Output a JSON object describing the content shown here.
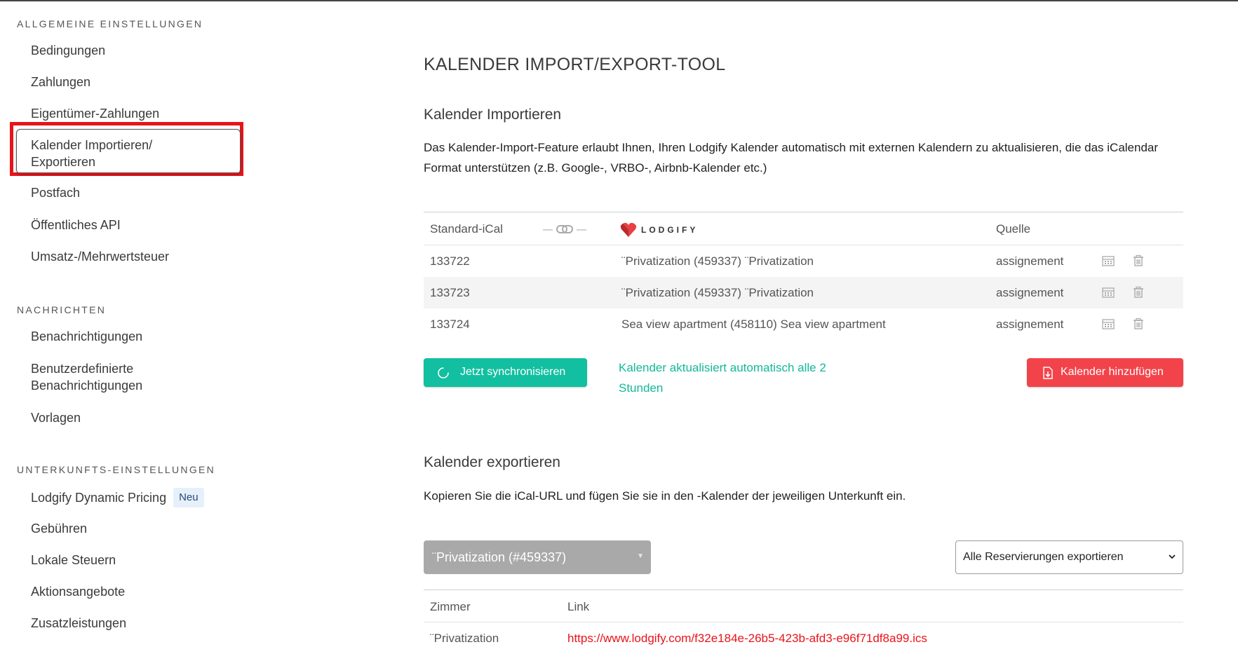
{
  "sidebar": {
    "sections": [
      {
        "heading": "ALLGEMEINE EINSTELLUNGEN",
        "items": [
          "Bedingungen",
          "Zahlungen",
          "Eigentümer-Zahlungen",
          "Kalender Importieren/ Exportieren",
          "Postfach",
          "Öffentliches API",
          "Umsatz-/Mehrwertsteuer"
        ]
      },
      {
        "heading": "NACHRICHTEN",
        "items": [
          "Benachrichtigungen",
          "Benutzerdefinierte Benachrichtigungen",
          "Vorlagen"
        ]
      },
      {
        "heading": "UNTERKUNFTS-EINSTELLUNGEN",
        "items": [
          "Lodgify Dynamic Pricing",
          "Gebühren",
          "Lokale Steuern",
          "Aktionsangebote",
          "Zusatzleistungen"
        ]
      }
    ],
    "new_badge": "Neu",
    "active_item": "Kalender Importieren/ Exportieren"
  },
  "main": {
    "title": "KALENDER IMPORT/EXPORT-TOOL",
    "import": {
      "heading": "Kalender Importieren",
      "description": "Das Kalender-Import-Feature erlaubt Ihnen, Ihren Lodgify Kalender automatisch mit externen Kalendern zu aktualisieren, die das iCalendar Format unterstützen (z.B. Google-, VRBO-, Airbnb-Kalender etc.)",
      "columns": {
        "ical": "Standard-iCal",
        "logo": "LODGIFY",
        "source": "Quelle"
      },
      "rows": [
        {
          "id": "133722",
          "property": "¨Privatization (459337) ¨Privatization",
          "source": "assignement"
        },
        {
          "id": "133723",
          "property": "¨Privatization (459337) ¨Privatization",
          "source": "assignement"
        },
        {
          "id": "133724",
          "property": "Sea view apartment (458110) Sea view apartment",
          "source": "assignement"
        }
      ],
      "sync_button": "Jetzt synchronisieren",
      "auto_note": "Kalender aktualisiert automatisch alle 2 Stunden",
      "add_button": "Kalender hinzufügen"
    },
    "export": {
      "heading": "Kalender exportieren",
      "description": "Kopieren Sie die iCal-URL und fügen Sie sie in den -Kalender der jeweiligen Unterkunft ein.",
      "property_select": "¨Privatization (#459337)",
      "export_select": "Alle Reservierungen exportieren",
      "columns": {
        "room": "Zimmer",
        "link": "Link"
      },
      "rows": [
        {
          "room": "¨Privatization",
          "link": "https://www.lodgify.com/f32e184e-26b5-423b-afd3-e96f71df8a99.ics"
        }
      ]
    }
  },
  "colors": {
    "accent_teal": "#12bfa0",
    "accent_red": "#f3434a",
    "highlight_red": "#e8141a"
  }
}
